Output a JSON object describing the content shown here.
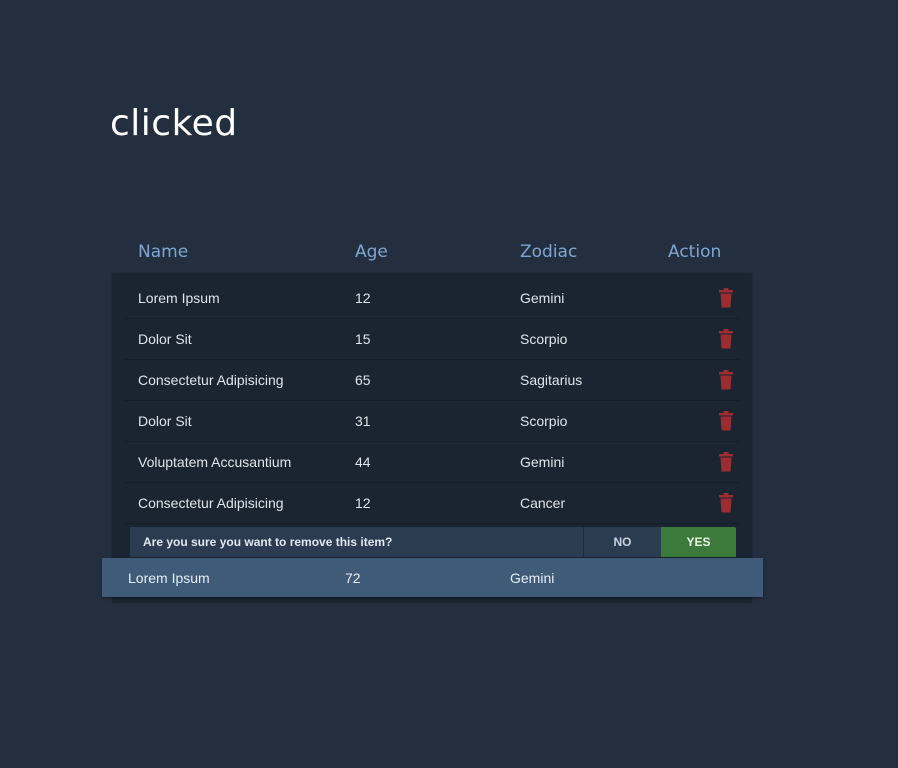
{
  "page": {
    "title": "clicked"
  },
  "table": {
    "headers": {
      "name": "Name",
      "age": "Age",
      "zodiac": "Zodiac",
      "action": "Action"
    },
    "rows": [
      {
        "name": "Lorem Ipsum",
        "age": "12",
        "zodiac": "Gemini"
      },
      {
        "name": "Dolor Sit",
        "age": "15",
        "zodiac": "Scorpio"
      },
      {
        "name": "Consectetur Adipisicing",
        "age": "65",
        "zodiac": "Sagitarius"
      },
      {
        "name": "Dolor Sit",
        "age": "31",
        "zodiac": "Scorpio"
      },
      {
        "name": "Voluptatem Accusantium",
        "age": "44",
        "zodiac": "Gemini"
      },
      {
        "name": "Consectetur Adipisicing",
        "age": "12",
        "zodiac": "Cancer"
      }
    ],
    "delete_icon": "trash-icon",
    "delete_color": "#9b2d31"
  },
  "confirm": {
    "message": "Are you sure you want to remove this item?",
    "no_label": "NO",
    "yes_label": "YES",
    "yes_color": "#3b7a3a"
  },
  "selected_row": {
    "name": "Lorem Ipsum",
    "age": "72",
    "zodiac": "Gemini"
  }
}
